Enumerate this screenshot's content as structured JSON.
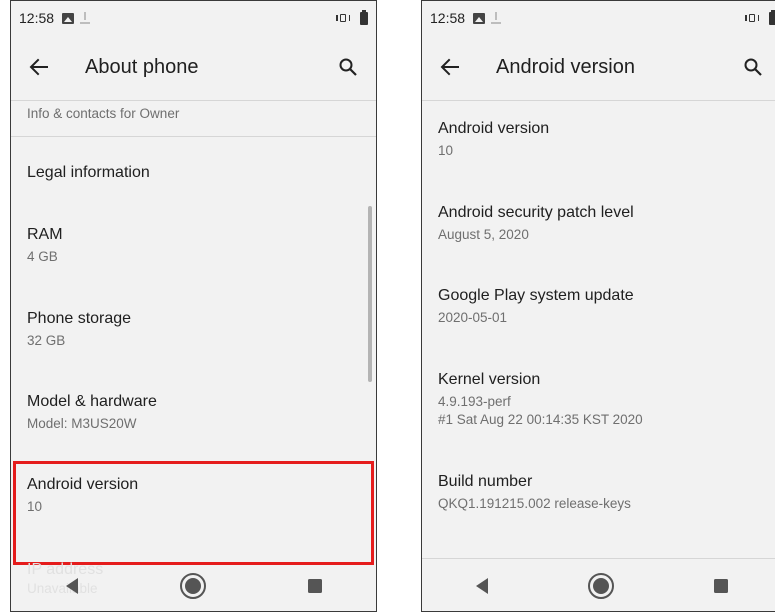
{
  "left_screen": {
    "status": {
      "time": "12:58"
    },
    "title": "About phone",
    "partial_top_item": {
      "sub": "Info & contacts for Owner"
    },
    "items": [
      {
        "title": "Legal information",
        "sub": ""
      },
      {
        "title": "RAM",
        "sub": "4 GB"
      },
      {
        "title": "Phone storage",
        "sub": "32 GB"
      },
      {
        "title": "Model & hardware",
        "sub": "Model: M3US20W"
      },
      {
        "title": "Android version",
        "sub": "10"
      }
    ],
    "faded_item": {
      "title": "IP address",
      "sub": "Unavailable"
    }
  },
  "right_screen": {
    "status": {
      "time": "12:58"
    },
    "title": "Android version",
    "items": [
      {
        "title": "Android version",
        "sub": "10"
      },
      {
        "title": "Android security patch level",
        "sub": "August 5, 2020"
      },
      {
        "title": "Google Play system update",
        "sub": "2020-05-01"
      },
      {
        "title": "Kernel version",
        "sub": "4.9.193-perf",
        "sub2": "#1 Sat Aug 22 00:14:35 KST 2020"
      },
      {
        "title": "Build number",
        "sub": "QKQ1.191215.002 release-keys"
      }
    ]
  },
  "icons": {
    "back": "arrow-back-icon",
    "search": "search-icon",
    "nav_back": "triangle-back-icon",
    "nav_home": "circle-home-icon",
    "nav_recents": "square-recents-icon"
  },
  "colors": {
    "highlight": "#e51c1c",
    "screen_background": "#f2f2f2",
    "divider": "#d6d6d6"
  }
}
